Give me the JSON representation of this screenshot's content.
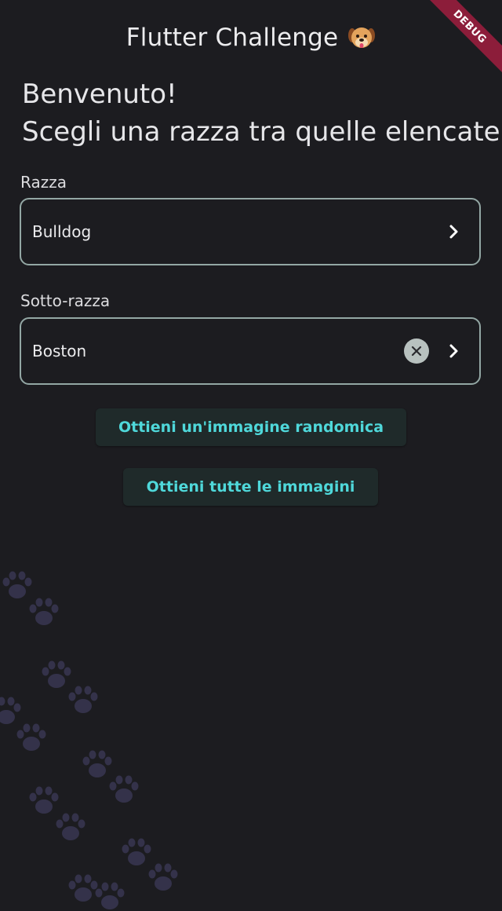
{
  "appbar": {
    "title": "Flutter Challenge",
    "emoji_icon": "dog-face-icon",
    "debug_banner": "DEBUG"
  },
  "welcome": {
    "line1": "Benvenuto!",
    "line2": "Scegli una razza tra quelle elencate"
  },
  "breed": {
    "label": "Razza",
    "value": "Bulldog"
  },
  "sub_breed": {
    "label": "Sotto-razza",
    "value": "Boston"
  },
  "actions": {
    "random_image": "Ottieni un'immagine randomica",
    "all_images": "Ottieni tutte le immagini"
  },
  "colors": {
    "background": "#1c1c20",
    "accent": "#4fd8da",
    "field_border": "#93a7a4",
    "paw": "#34324a",
    "debug_ribbon": "#8c1d3a"
  }
}
